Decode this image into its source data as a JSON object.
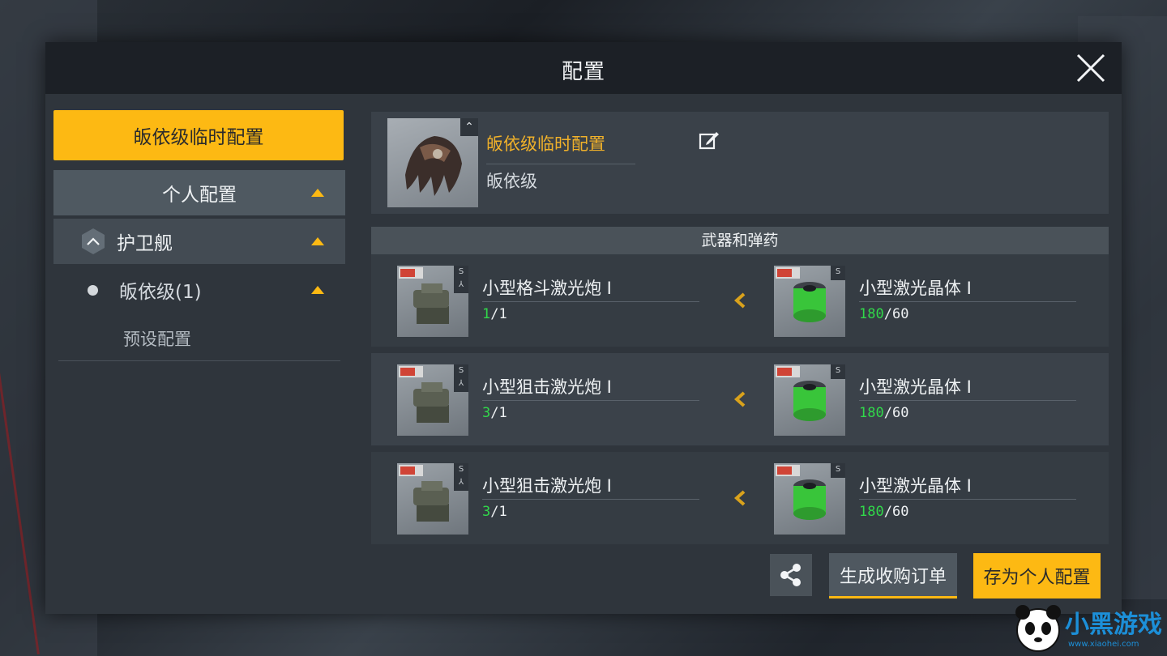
{
  "modal": {
    "title": "配置"
  },
  "left": {
    "temp_button": "皈依级临时配置",
    "personal_label": "个人配置",
    "frigate_label": "护卫舰",
    "ship_label": "皈依级(1)",
    "preset_label": "预设配置"
  },
  "ship": {
    "name": "皈依级临时配置",
    "class": "皈依级"
  },
  "weapons": {
    "header": "武器和弹药",
    "slots": [
      {
        "weapon": {
          "name": "小型格斗激光炮 I",
          "count_current": "1",
          "count_total": "/1",
          "size": "S"
        },
        "ammo": {
          "name": "小型激光晶体 I",
          "count_current": "180",
          "count_total": "/60",
          "size": "S"
        }
      },
      {
        "weapon": {
          "name": "小型狙击激光炮 I",
          "count_current": "3",
          "count_total": "/1",
          "size": "S"
        },
        "ammo": {
          "name": "小型激光晶体 I",
          "count_current": "180",
          "count_total": "/60",
          "size": "S"
        }
      },
      {
        "weapon": {
          "name": "小型狙击激光炮 I",
          "count_current": "3",
          "count_total": "/1",
          "size": "S"
        },
        "ammo": {
          "name": "小型激光晶体 I",
          "count_current": "180",
          "count_total": "/60",
          "size": "S"
        }
      }
    ]
  },
  "footer": {
    "order_button": "生成收购订单",
    "save_button": "存为个人配置"
  },
  "watermark": {
    "brand": "小黑游戏",
    "url": "www.xiaohei.com"
  },
  "colors": {
    "accent": "#fdb913",
    "count_green": "#31d84a",
    "ship_name": "#f0b12a"
  },
  "icons": [
    "close-icon",
    "caret-up-icon",
    "hexagon-icon",
    "edit-icon",
    "chevron-left-icon",
    "share-icon"
  ]
}
